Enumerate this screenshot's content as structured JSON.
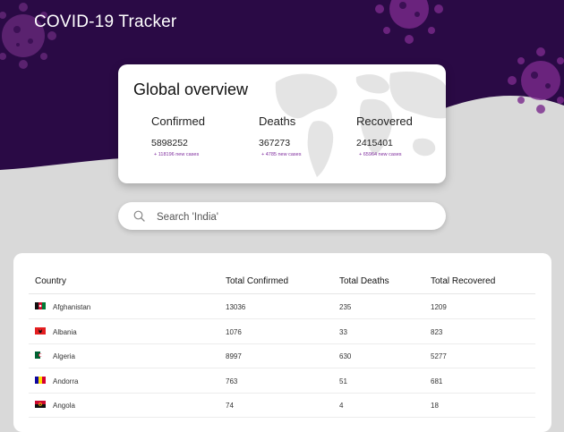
{
  "app": {
    "title": "COVID-19 Tracker"
  },
  "overview": {
    "title": "Global overview",
    "stats": [
      {
        "label": "Confirmed",
        "value": "5898252",
        "new_cases": "+ 118196 new cases"
      },
      {
        "label": "Deaths",
        "value": "367273",
        "new_cases": "+ 4785 new cases"
      },
      {
        "label": "Recovered",
        "value": "2415401",
        "new_cases": "+ 65964 new cases"
      }
    ]
  },
  "search": {
    "placeholder": "Search 'India'",
    "icon": "search-icon"
  },
  "table": {
    "headers": [
      "Country",
      "Total Confirmed",
      "Total Deaths",
      "Total Recovered"
    ],
    "rows": [
      {
        "country": "Afghanistan",
        "confirmed": "13036",
        "deaths": "235",
        "recovered": "1209",
        "flag": "afghanistan-flag-icon"
      },
      {
        "country": "Albania",
        "confirmed": "1076",
        "deaths": "33",
        "recovered": "823",
        "flag": "albania-flag-icon"
      },
      {
        "country": "Algeria",
        "confirmed": "8997",
        "deaths": "630",
        "recovered": "5277",
        "flag": "algeria-flag-icon"
      },
      {
        "country": "Andorra",
        "confirmed": "763",
        "deaths": "51",
        "recovered": "681",
        "flag": "andorra-flag-icon"
      },
      {
        "country": "Angola",
        "confirmed": "74",
        "deaths": "4",
        "recovered": "18",
        "flag": "angola-flag-icon"
      }
    ]
  },
  "colors": {
    "hero_background": "#2a0a45",
    "virus": "#7a2a8c",
    "page_background": "#d9d9d9",
    "new_cases_text": "#7d2a9c"
  }
}
